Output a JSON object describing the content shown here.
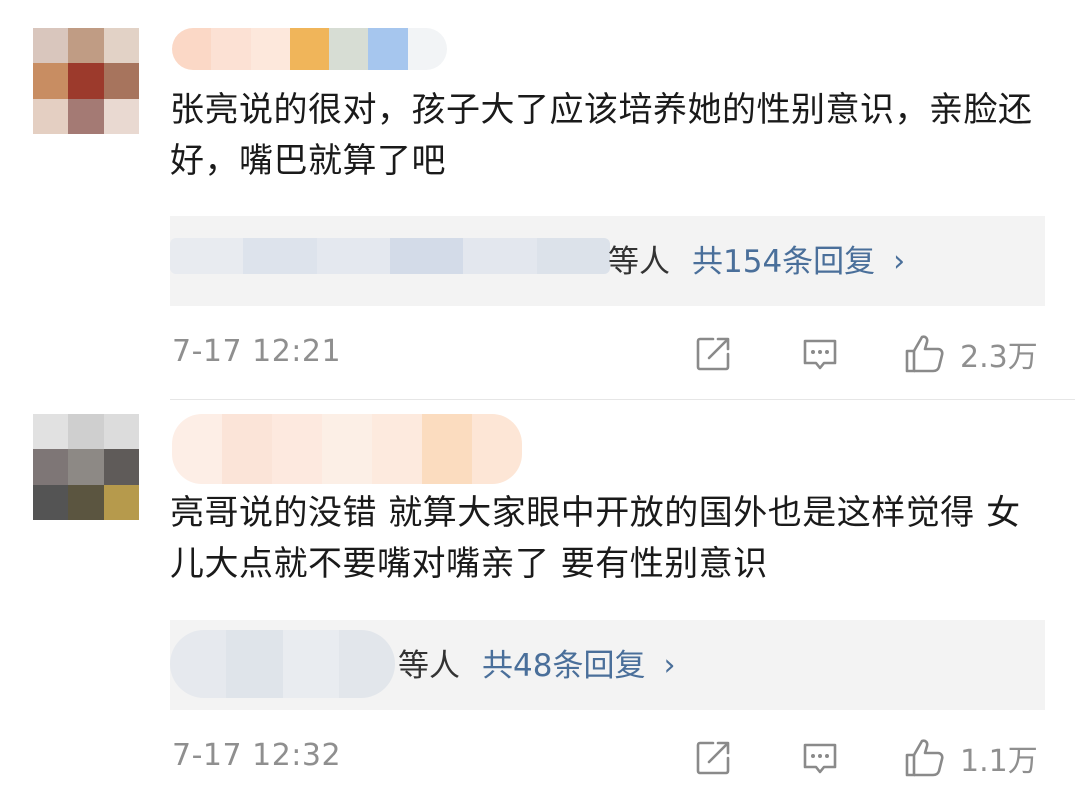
{
  "comments": [
    {
      "text": "张亮说的很对，孩子大了应该培养她的性别意识，亲脸还好，嘴巴就算了吧",
      "replies": {
        "others_label": "等人",
        "count_label": "共154条回复",
        "chevron": "›"
      },
      "timestamp": "7-17 12:21",
      "likes": "2.3万",
      "avatar_colors": [
        "#d9c6bd",
        "#c09c84",
        "#e2d2c6",
        "#c88d62",
        "#9c3a2c",
        "#a7745d",
        "#e4cfc2",
        "#a47a74",
        "#e9d9d1"
      ],
      "username_colors": [
        "#fbd8c6",
        "#fce1d4",
        "#fde8dc",
        "#f0b55a",
        "#d7ddd4",
        "#a6c6ee",
        "#f2f4f6"
      ],
      "reply_blur_colors": [
        "#e8ebf0",
        "#dde3ec",
        "#e4e8ef",
        "#d3dbe8",
        "#e3e7ee",
        "#dce2ea"
      ]
    },
    {
      "text": "亮哥说的没错 就算大家眼中开放的国外也是这样觉得 女儿大点就不要嘴对嘴亲了 要有性别意识",
      "replies": {
        "others_label": "等人",
        "count_label": "共48条回复",
        "chevron": "›"
      },
      "timestamp": "7-17 12:32",
      "likes": "1.1万",
      "avatar_colors": [
        "#e1e1e1",
        "#cfcfcf",
        "#dcdcdc",
        "#7e7676",
        "#8d8985",
        "#5f5b59",
        "#545454",
        "#5b5540",
        "#b69a4c"
      ],
      "username_colors": [
        "#fdeee6",
        "#fbe4d8",
        "#fde9df",
        "#fcefe6",
        "#fdeade",
        "#fbdcbf",
        "#fde6d6"
      ],
      "reply_blur_colors": [
        "#e6e9ee",
        "#dfe4ea",
        "#e9ecf0",
        "#e2e6eb"
      ]
    }
  ],
  "icons": {
    "forward": "edit-square-icon",
    "comment": "comment-bubble-icon",
    "like": "thumbs-up-icon"
  },
  "colors": {
    "reply_link": "#4a6f9a",
    "meta_gray": "#8f8f8f",
    "reply_bg": "#f3f3f3"
  }
}
